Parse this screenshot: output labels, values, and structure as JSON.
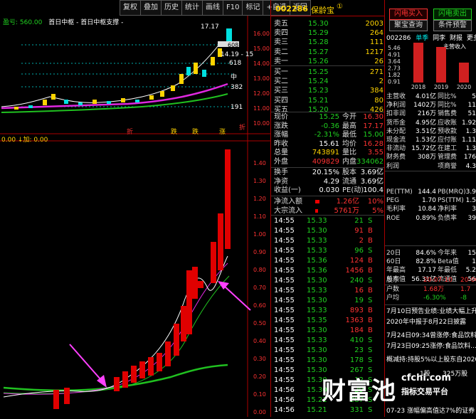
{
  "toolbar": [
    "复权",
    "叠加",
    "历史",
    "统计",
    "画线",
    "F10",
    "标记",
    "+自选",
    "返回"
  ],
  "indicator_top": {
    "label": "盈亏: 560.00",
    "name": "首日中枢 - 首日中枢支撑 -"
  },
  "indicator_bottom": {
    "label": "0.00 ↓加: 0.00"
  },
  "top_chart_labels": {
    "sell_box": "17.17",
    "b1": "608",
    "b2": "14.19 - 15",
    "b3": "618",
    "b4": "中",
    "b5": "382",
    "b6": "191",
    "b7": "折"
  },
  "axis_top": [
    "16.00",
    "15.00",
    "14.00",
    "13.00",
    "12.00",
    "11.00",
    "10.00"
  ],
  "axis_bottom": [
    "1.40",
    "1.30",
    "1.20",
    "1.10",
    "1.00",
    "0.90",
    "0.80",
    "0.70",
    "0.60",
    "0.50",
    "0.40",
    "0.30",
    "0.20",
    "0.10",
    "0.00"
  ],
  "bottom_marks": [
    "折",
    "折",
    "跌",
    "跌",
    "涨"
  ],
  "stock": {
    "code": "002286",
    "name": "保龄宝",
    "badge": "①"
  },
  "orderbook": [
    {
      "label": "卖五",
      "price": "15.30",
      "vol": "2003"
    },
    {
      "label": "卖四",
      "price": "15.29",
      "vol": "264"
    },
    {
      "label": "卖三",
      "price": "15.28",
      "vol": "111"
    },
    {
      "label": "卖二",
      "price": "15.27",
      "vol": "1217"
    },
    {
      "label": "卖一",
      "price": "15.26",
      "vol": "26"
    },
    {
      "label": "买一",
      "price": "15.25",
      "vol": "271"
    },
    {
      "label": "买二",
      "price": "15.24",
      "vol": "2"
    },
    {
      "label": "买三",
      "price": "15.23",
      "vol": "384"
    },
    {
      "label": "买四",
      "price": "15.21",
      "vol": "80"
    },
    {
      "label": "买五",
      "price": "15.20",
      "vol": "426"
    }
  ],
  "quote": [
    {
      "l": "现价",
      "v": "15.25",
      "l2": "今开",
      "v2": "16.30"
    },
    {
      "l": "涨跌",
      "v": "-0.36",
      "l2": "最高",
      "v2": "17.17"
    },
    {
      "l": "涨幅",
      "v": "-2.31%",
      "l2": "最低",
      "v2": "15.00"
    },
    {
      "l": "昨收",
      "v": "15.61",
      "l2": "均价",
      "v2": "16.28"
    },
    {
      "l": "总量",
      "v": "743891",
      "l2": "量比",
      "v2": "3.55"
    },
    {
      "l": "外盘",
      "v": "409829",
      "l2": "内盘",
      "v2": "334062"
    }
  ],
  "quote2": [
    {
      "l": "换手",
      "v": "20.15%",
      "l2": "股本",
      "v2": "3.69亿"
    },
    {
      "l": "净资",
      "v": "4.29",
      "l2": "流通",
      "v2": "3.69亿"
    },
    {
      "l": "收益(一)",
      "v": "0.030",
      "l2": "PE(动)",
      "v2": "100.4"
    }
  ],
  "flow": [
    {
      "l": "净流入额",
      "v": "1.26亿",
      "p": "10%"
    },
    {
      "l": "大宗流入",
      "v": "5761万",
      "p": "5%"
    }
  ],
  "ticks": [
    {
      "t": "14:55",
      "p": "15.33",
      "v": "21",
      "s": "S"
    },
    {
      "t": "14:55",
      "p": "15.30",
      "v": "91",
      "s": "B"
    },
    {
      "t": "14:55",
      "p": "15.33",
      "v": "2",
      "s": "B"
    },
    {
      "t": "14:55",
      "p": "15.33",
      "v": "96",
      "s": "S"
    },
    {
      "t": "14:55",
      "p": "15.36",
      "v": "124",
      "s": "B"
    },
    {
      "t": "14:55",
      "p": "15.36",
      "v": "1456",
      "s": "B"
    },
    {
      "t": "14:55",
      "p": "15.30",
      "v": "240",
      "s": "S"
    },
    {
      "t": "14:55",
      "p": "15.33",
      "v": "16",
      "s": "B"
    },
    {
      "t": "14:55",
      "p": "15.30",
      "v": "19",
      "s": "S"
    },
    {
      "t": "14:55",
      "p": "15.33",
      "v": "893",
      "s": "B"
    },
    {
      "t": "14:55",
      "p": "15.35",
      "v": "1363",
      "s": "B"
    },
    {
      "t": "14:55",
      "p": "15.30",
      "v": "184",
      "s": "B"
    },
    {
      "t": "14:55",
      "p": "15.33",
      "v": "410",
      "s": "S"
    },
    {
      "t": "14:55",
      "p": "15.30",
      "v": "23",
      "s": "S"
    },
    {
      "t": "14:55",
      "p": "15.30",
      "v": "178",
      "s": "S"
    },
    {
      "t": "14:55",
      "p": "15.30",
      "v": "267",
      "s": "S"
    },
    {
      "t": "14:55",
      "p": "15.30",
      "v": "12",
      "s": "S"
    },
    {
      "t": "14:56",
      "p": "15.30",
      "v": "29",
      "s": "S"
    },
    {
      "t": "14:56",
      "p": "15.21",
      "v": "287",
      "s": "S"
    },
    {
      "t": "14:56",
      "p": "15.21",
      "v": "331",
      "s": "S"
    }
  ],
  "right_buttons": {
    "b1": "闪电买入",
    "b2": "闪电卖出",
    "b3": "聚宝查询",
    "b4": "条件预警"
  },
  "right_header": {
    "code": "002286",
    "tab1": "单季",
    "tab2": "同李",
    "tab3": "财报",
    "tab4": "更多",
    "sub": "主营收入"
  },
  "bar_years": [
    "2018",
    "2019",
    "2020"
  ],
  "bar_values_label": [
    "5.46",
    "4.91",
    "3.64",
    "2.73",
    "1.82",
    "0.91"
  ],
  "fin": [
    {
      "l": "主营收",
      "v": "4.01亿",
      "l2": "同比%",
      "v2": "5"
    },
    {
      "l": "净利润",
      "v": "1402万",
      "l2": "同比%",
      "v2": "11"
    },
    {
      "l": "扣非润",
      "v": "216万",
      "l2": "销售费",
      "v2": "51"
    },
    {
      "l": "货币金",
      "v": "4.95亿",
      "l2": "应收账",
      "v2": "1.92"
    },
    {
      "l": "未分配",
      "v": "3.51亿",
      "l2": "预收款",
      "v2": "1.3"
    },
    {
      "l": "现金流",
      "v": "1.53亿",
      "l2": "应付账",
      "v2": "1.11"
    },
    {
      "l": "非流动",
      "v": "15.72亿",
      "l2": "在建工",
      "v2": "1.3"
    },
    {
      "l": "财务费",
      "v": "308万",
      "l2": "管理费",
      "v2": "176"
    },
    {
      "l": "利润",
      "v": "",
      "l2": "项商誉",
      "v2": "4.3"
    }
  ],
  "val": [
    {
      "l": "PE(TTM)",
      "v": "144.4",
      "l2": "PB(MRQ)",
      "v2": "3.9"
    },
    {
      "l": "PEG",
      "v": "1.70",
      "l2": "PS(TTM)",
      "v2": "1.5"
    },
    {
      "l": "毛利率",
      "v": "10.84",
      "l2": "净利率",
      "v2": "3"
    },
    {
      "l": "ROE",
      "v": "0.89%",
      "l2": "负债率",
      "v2": "39"
    }
  ],
  "stat": [
    {
      "l": "20日",
      "v": "84.6%",
      "l2": "今年来",
      "v2": "15"
    },
    {
      "l": "60日",
      "v": "82.8%",
      "l2": "Beta值",
      "v2": "1"
    },
    {
      "l": "年最高",
      "v": "17.17",
      "l2": "年最低",
      "v2": "5.2"
    },
    {
      "l": "总市值",
      "v": "56.31亿",
      "l2": "流通值",
      "v2": "56"
    }
  ],
  "holders": [
    {
      "l": "股东",
      "v": "20-07-10",
      "v2": "20-06"
    },
    {
      "l": "户数",
      "v": "1.68万",
      "v2": "1.7"
    },
    {
      "l": "户均",
      "v": "-6.30%",
      "v2": "-8"
    }
  ],
  "news": [
    "7月10日预告业绩:业绩大幅上升",
    "2020年中报于8月22日披露",
    "7月24日09:34曾涨停:食品饮料",
    "7月23日09:25涨停:食品饮料...",
    "概减持:持股5%以上股东自2020",
    "07-23 涨幅偏高值达7%的证券"
  ],
  "watermark": {
    "t1": "财富池",
    "t2": "cfchi.com",
    "t3": "指标交易平台",
    "t4": "1股",
    "t5": "325万股"
  }
}
